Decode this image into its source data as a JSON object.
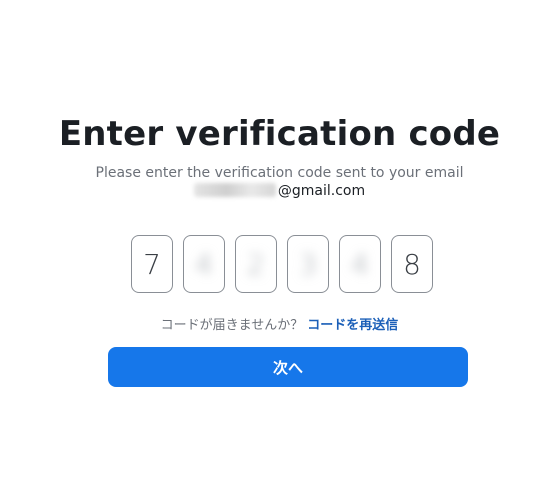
{
  "page": {
    "title": "Enter verification code",
    "subtitle": "Please enter the verification code sent to your email",
    "email_domain": "@gmail.com"
  },
  "code": {
    "digits": [
      "7",
      "4",
      "2",
      "3",
      "4",
      "8"
    ]
  },
  "resend": {
    "question": "コードが届きませんか？",
    "link_label": "コードを再送信"
  },
  "actions": {
    "next_label": "次へ"
  },
  "colors": {
    "primary": "#1677ea",
    "link": "#1b5fb8",
    "title": "#1b1f24",
    "muted": "#6b7078"
  }
}
